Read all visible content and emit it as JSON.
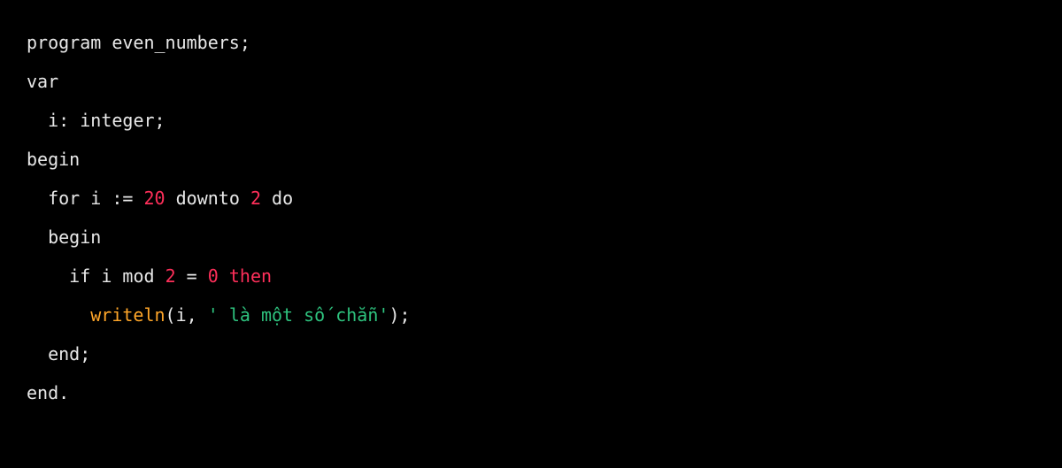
{
  "code": {
    "l1": {
      "kw_program": "program",
      "ident": "even_numbers",
      "semi": ";"
    },
    "l2": {
      "kw_var": "var"
    },
    "l3": {
      "ident_i": "i",
      "colon": ":",
      "type": "integer",
      "semi": ";"
    },
    "l4": {
      "kw_begin": "begin"
    },
    "l5": {
      "kw_for": "for",
      "ident_i": "i",
      "assign": ":=",
      "n20": "20",
      "kw_downto": "downto",
      "n2": "2",
      "kw_do": "do"
    },
    "l6": {
      "kw_begin": "begin"
    },
    "l7": {
      "kw_if": "if",
      "ident_i": "i",
      "kw_mod": "mod",
      "n2": "2",
      "eq": "=",
      "n0": "0",
      "kw_then": "then"
    },
    "l8": {
      "func": "writeln",
      "lp": "(",
      "ident_i": "i",
      "comma": ",",
      "str": "' là một số chẵn'",
      "rp": ")",
      "semi": ";"
    },
    "l9": {
      "kw_end": "end",
      "semi": ";"
    },
    "l10": {
      "kw_end": "end",
      "dot": "."
    }
  }
}
